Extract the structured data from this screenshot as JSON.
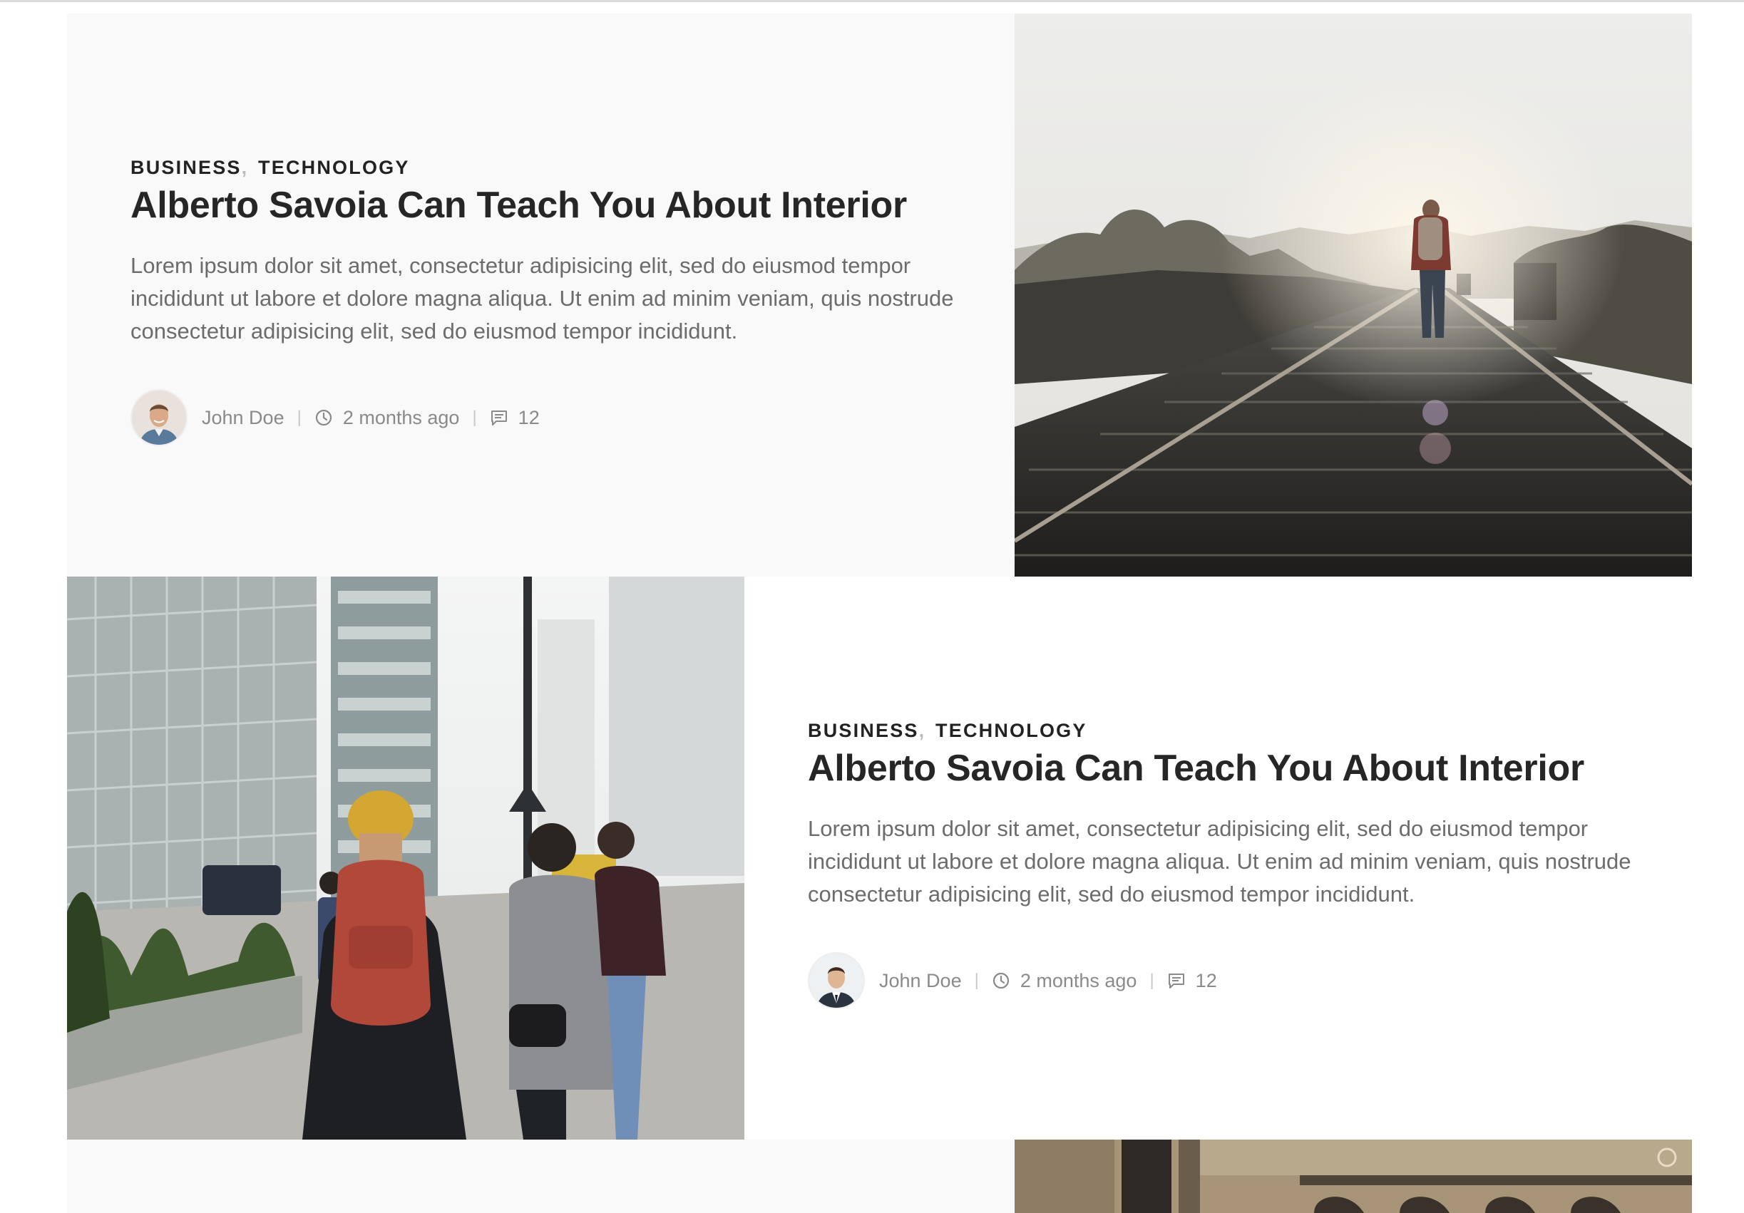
{
  "posts": [
    {
      "category_1": "BUSINESS",
      "category_sep": ",",
      "category_2": "TECHNOLOGY",
      "title": "Alberto Savoia Can Teach You About Interior",
      "excerpt": "Lorem ipsum dolor sit amet, consectetur adipisicing elit, sed do eiusmod tempor incididunt ut labore et dolore magna aliqua. Ut enim ad minim veniam, quis nostrude consectetur adipisicing elit, sed do eiusmod tempor incididunt.",
      "author": "John Doe",
      "date": "2 months ago",
      "comments": "12"
    },
    {
      "category_1": "BUSINESS",
      "category_sep": ",",
      "category_2": "TECHNOLOGY",
      "title": "Alberto Savoia Can Teach You About Interior",
      "excerpt": "Lorem ipsum dolor sit amet, consectetur adipisicing elit, sed do eiusmod tempor incididunt ut labore et dolore magna aliqua. Ut enim ad minim veniam, quis nostrude consectetur adipisicing elit, sed do eiusmod tempor incididunt.",
      "author": "John Doe",
      "date": "2 months ago",
      "comments": "12"
    }
  ],
  "meta_separator": "|",
  "icons": {
    "clock": "clock-icon",
    "comments": "comment-icon"
  },
  "colors": {
    "row_alt_bg": "#f9f9f9",
    "title": "#262626",
    "excerpt": "#6c6c6c",
    "meta": "#8a8a8a"
  }
}
